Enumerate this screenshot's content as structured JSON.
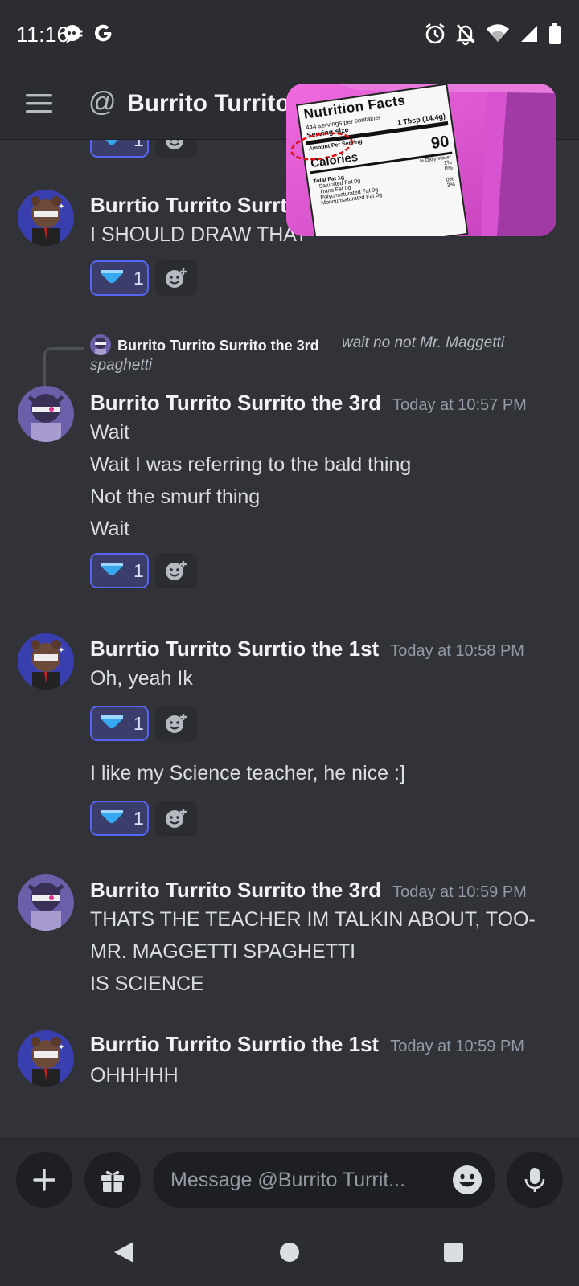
{
  "status_bar": {
    "time": "11:16",
    "left_icons": [
      "chat-bubble-icon",
      "google-g-icon"
    ],
    "right_icons": [
      "alarm-icon",
      "notifications-off-icon",
      "wifi-icon",
      "signal-icon",
      "battery-icon"
    ]
  },
  "header": {
    "title": "Burrito Turrito"
  },
  "pip": {
    "label_title": "Nutrition Facts",
    "servings_line": "444 servings per container",
    "serving_size_label": "Serving size",
    "serving_size_value": "1 Tbsp (14.4g)",
    "amount_per_serving": "Amount Per Serving",
    "calories_label": "Calories",
    "calories_value": "90",
    "daily_value_label": "% Daily Value*",
    "total_fat": "Total Fat 1g",
    "saturated_fat": "Saturated Fat 0g",
    "trans_fat": "Trans Fat 0g",
    "polyunsaturated_fat": "Polyunsaturated Fat 0g",
    "monounsaturated_fat": "Monounsaturated Fat 0g",
    "pct_1": "1%",
    "pct_2": "0%",
    "pct_3": "0%",
    "pct_4": "3%"
  },
  "messages": [
    {
      "author": "Burrtio Turrito Surrtio the 1st",
      "lines": [
        "I SHOULD DRAW THAT"
      ],
      "reaction_count": "1"
    },
    {
      "reply": {
        "author": "Burrito Turrito Surrito the 3rd",
        "text_line1": "wait no not Mr. Maggetti",
        "text_line2": "spaghetti"
      },
      "author": "Burrito Turrito Surrito the 3rd",
      "timestamp": "Today at 10:57 PM",
      "lines": [
        "Wait",
        "Wait I was referring to the bald thing",
        "Not the smurf thing",
        "Wait"
      ],
      "reaction_count": "1"
    },
    {
      "author": "Burrtio Turrito Surrtio the 1st",
      "timestamp": "Today at 10:58 PM",
      "lines": [
        "Oh, yeah Ik"
      ],
      "reaction_count": "1",
      "followup": "I like my Science teacher, he nice :]",
      "followup_reaction_count": "1"
    },
    {
      "author": "Burrito Turrito Surrito the 3rd",
      "timestamp": "Today at 10:59 PM",
      "lines": [
        "THATS THE TEACHER IM TALKIN ABOUT, TOO-",
        "MR. MAGGETTI SPAGHETTI",
        "IS SCIENCE"
      ]
    },
    {
      "author": "Burrtio Turrito Surrtio the 1st",
      "timestamp": "Today at 10:59 PM",
      "lines": [
        "OHHHHH"
      ]
    }
  ],
  "top_partial_reaction_count": "1",
  "composer": {
    "placeholder": "Message @Burrito Turrit..."
  },
  "colors": {
    "background": "#313338",
    "header": "#2b2d31",
    "reaction_bg": "#3b3d6b",
    "reaction_border": "#5865f2",
    "timestamp": "#949ba4"
  }
}
